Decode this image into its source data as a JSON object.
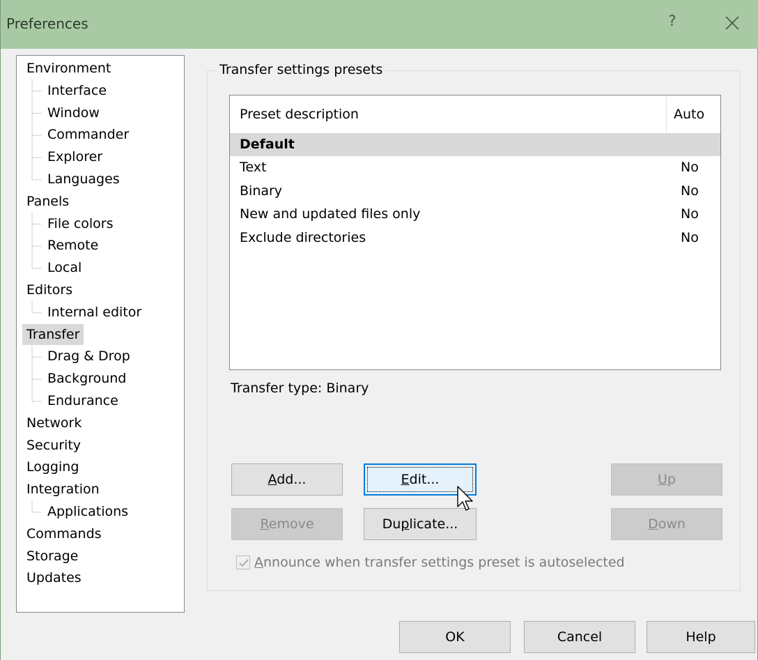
{
  "window": {
    "title": "Preferences",
    "help_glyph": "?",
    "close_icon": "close-icon"
  },
  "tree": {
    "selected": "Transfer",
    "items": [
      {
        "label": "Environment",
        "level": 0
      },
      {
        "label": "Interface",
        "level": 1
      },
      {
        "label": "Window",
        "level": 1
      },
      {
        "label": "Commander",
        "level": 1
      },
      {
        "label": "Explorer",
        "level": 1
      },
      {
        "label": "Languages",
        "level": 1
      },
      {
        "label": "Panels",
        "level": 0
      },
      {
        "label": "File colors",
        "level": 1
      },
      {
        "label": "Remote",
        "level": 1
      },
      {
        "label": "Local",
        "level": 1
      },
      {
        "label": "Editors",
        "level": 0
      },
      {
        "label": "Internal editor",
        "level": 1
      },
      {
        "label": "Transfer",
        "level": 0
      },
      {
        "label": "Drag & Drop",
        "level": 1
      },
      {
        "label": "Background",
        "level": 1
      },
      {
        "label": "Endurance",
        "level": 1
      },
      {
        "label": "Network",
        "level": 0
      },
      {
        "label": "Security",
        "level": 0
      },
      {
        "label": "Logging",
        "level": 0
      },
      {
        "label": "Integration",
        "level": 0
      },
      {
        "label": "Applications",
        "level": 1
      },
      {
        "label": "Commands",
        "level": 0
      },
      {
        "label": "Storage",
        "level": 0
      },
      {
        "label": "Updates",
        "level": 0
      }
    ]
  },
  "presets": {
    "group_title": "Transfer settings presets",
    "columns": {
      "description": "Preset description",
      "auto": "Auto"
    },
    "rows": [
      {
        "description": "Default",
        "auto": "",
        "bold": true,
        "selected": true
      },
      {
        "description": "Text",
        "auto": "No"
      },
      {
        "description": "Binary",
        "auto": "No"
      },
      {
        "description": "New and updated files only",
        "auto": "No"
      },
      {
        "description": "Exclude directories",
        "auto": "No"
      }
    ],
    "transfer_type": "Transfer type: Binary"
  },
  "buttons": {
    "add": {
      "pre": "",
      "accel": "A",
      "post": "dd..."
    },
    "edit": {
      "pre": "",
      "accel": "E",
      "post": "dit..."
    },
    "up": {
      "pre": "",
      "accel": "U",
      "post": "p"
    },
    "remove": {
      "pre": "",
      "accel": "R",
      "post": "emove"
    },
    "duplicate": {
      "pre": "Du",
      "accel": "p",
      "post": "licate..."
    },
    "down": {
      "pre": "",
      "accel": "D",
      "post": "own"
    }
  },
  "announce_checkbox": {
    "pre": "",
    "accel": "A",
    "post": "nnounce when transfer settings preset is autoselected",
    "checked": true,
    "enabled": false
  },
  "footer": {
    "ok": "OK",
    "cancel": "Cancel",
    "help": "Help"
  },
  "colors": {
    "titlebar": "#a9c9a4",
    "focus_border": "#0078d7",
    "selection": "#d9d9d9"
  }
}
